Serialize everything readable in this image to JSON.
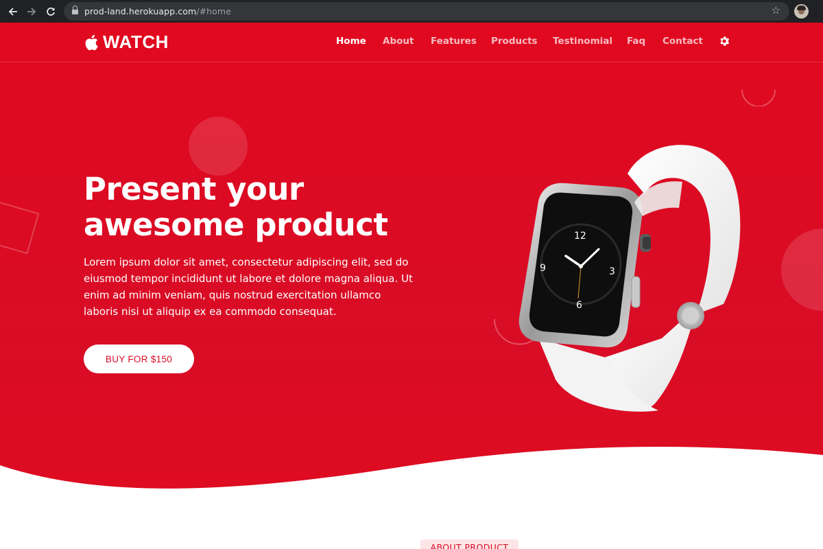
{
  "browser": {
    "url_host": "prod-land.herokuapp.com",
    "url_path": "/#home"
  },
  "brand": {
    "name": "WATCH"
  },
  "nav": {
    "items": [
      {
        "label": "Home",
        "active": true
      },
      {
        "label": "About",
        "active": false
      },
      {
        "label": "Features",
        "active": false
      },
      {
        "label": "Products",
        "active": false
      },
      {
        "label": "Testinomial",
        "active": false
      },
      {
        "label": "Faq",
        "active": false
      },
      {
        "label": "Contact",
        "active": false
      }
    ]
  },
  "hero": {
    "headline_line1": "Present your",
    "headline_line2": "awesome product",
    "description": "Lorem ipsum dolor sit amet, consectetur adipiscing elit, sed do eiusmod tempor incididunt ut labore et dolore magna aliqua. Ut enim ad minim veniam, quis nostrud exercitation ullamco laboris nisi ut aliquip ex ea commodo consequat.",
    "cta_label": "BUY FOR $150",
    "watch_numbers": [
      "12",
      "3",
      "6",
      "9"
    ]
  },
  "about": {
    "tag_label": "ABOUT PRODUCT"
  },
  "colors": {
    "brand_red": "#dc0a22",
    "chrome_bg": "#202124",
    "white": "#ffffff"
  },
  "icons": [
    "back-arrow-icon",
    "forward-arrow-icon",
    "reload-icon",
    "lock-icon",
    "star-icon",
    "apple-icon",
    "gear-icon"
  ]
}
